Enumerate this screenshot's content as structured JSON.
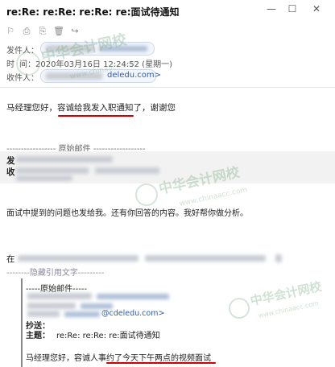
{
  "window": {
    "title": "re:Re: re:Re: re:Re: re:面试待通知",
    "minimize": "—",
    "maximize": "☐",
    "close": "✕"
  },
  "toolbar": {
    "icons": [
      "flag-icon",
      "print-icon",
      "attachment-icon",
      "delete-icon",
      "forward-icon"
    ],
    "glyphs": [
      "⚐",
      "⎙",
      "⎘",
      "🗑",
      "↪"
    ]
  },
  "header": {
    "sender_label": "发件人：",
    "time_label": "时",
    "time_value": "间：2020年03月16日 12:24:52 (星期一)",
    "recipient_label": "收件人：",
    "recipient_email": "deledu.com>"
  },
  "body": {
    "greeting": "马经理您好，容诚给我发入职通知了，谢谢您",
    "original_divider": "----------------- 原始邮件 ------------------",
    "from_char": "发",
    "to_char": "收",
    "question_line": "面试中提到的问题也发给我。还有你回答的内容。我好帮你做分析。",
    "partial_char": "在",
    "collapse_link": "--------隐藏引用文字---------",
    "inner_original": "-----原始邮件-----",
    "inner_email": "@cdeledu.com>",
    "cc_label": "抄送：",
    "subject_label": "主题：",
    "subject_value": "re:Re: re:Re: re:面试待通知",
    "final_line_prefix": "马经理您好，容诚人事约了",
    "final_line_highlight": "今天下午两点的视频面试"
  },
  "watermarks": {
    "wm1_cn": "中华会计网校",
    "wm1_en": "www.chinaacc.com",
    "wm2_cn": "中华会计网校",
    "wm2_en": "www.chinaacc.com",
    "wm3_cn": "中华会计网校",
    "wm3_en": "www.chinaacc.com"
  },
  "colors": {
    "accent_red": "#d40000",
    "link_blue": "#2a5db0"
  }
}
